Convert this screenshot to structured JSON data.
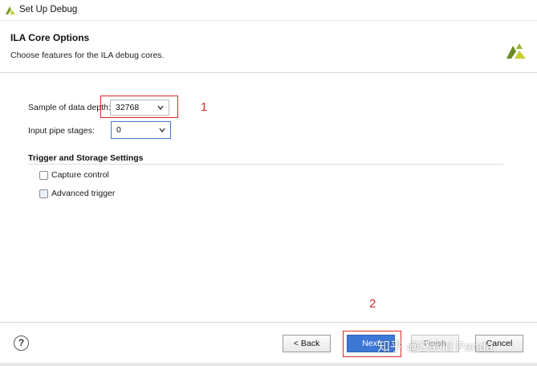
{
  "window": {
    "title": "Set Up Debug"
  },
  "header": {
    "title": "ILA Core Options",
    "subtitle": "Choose features for the ILA debug cores."
  },
  "form": {
    "sample_depth": {
      "label": "Sample of data depth:",
      "value": "32768"
    },
    "pipe_stages": {
      "label": "Input pipe stages:",
      "value": "0"
    }
  },
  "section": {
    "title": "Trigger and Storage Settings",
    "capture_control": {
      "label": "Capture control",
      "checked": false
    },
    "advanced_trigger": {
      "label": "Advanced trigger",
      "checked": false
    }
  },
  "annotations": {
    "one": "1",
    "two": "2"
  },
  "footer": {
    "help": "?",
    "back": "< Back",
    "next": "Next",
    "finish": "Finish",
    "cancel": "Cancel",
    "watermark": "知乎 @David Panda"
  },
  "colors": {
    "primary": "#3d78d6",
    "annotation": "#d62b2b",
    "focus": "#3f78c8"
  }
}
